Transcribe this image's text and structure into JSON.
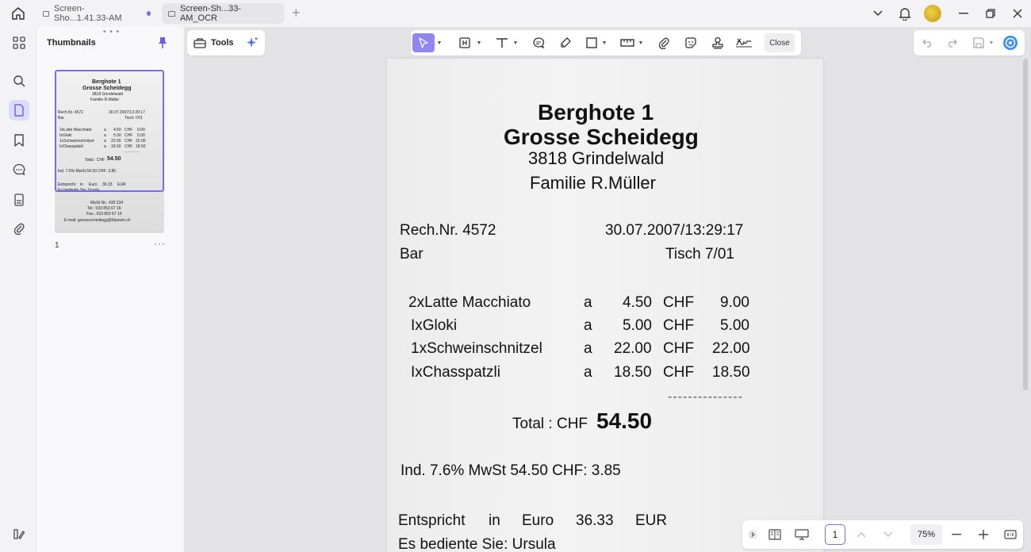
{
  "window": {
    "tabs": [
      {
        "label": "Screen-Sho...1.41.33-AM",
        "modified": true
      },
      {
        "label": "Screen-Sh...33-AM_OCR",
        "active": true
      }
    ]
  },
  "thumbnails": {
    "title": "Thumbnails",
    "page_number": "1",
    "more": "···",
    "preview_lines": [
      "Berghote 1",
      "Grosse Scheidegg",
      "3818 Grindelwald",
      "Familie R.Müller",
      "Rech.Nr. 4572",
      "30.07.2007/13:29:17",
      "Bar",
      "Tisch 7/01",
      "2xLatte Macchiato",
      "a",
      "4.50",
      "CHF",
      "9.00",
      "IxGloki",
      "a",
      "5.00",
      "CHF",
      "5.00",
      "1xSchweinschnitzel",
      "a",
      "22.00",
      "CHF",
      "22.00",
      "IxChasspätzli",
      "a",
      "18.50",
      "CHF",
      "18.50",
      "Total : CHF",
      "54.50",
      "Ind. 7.6% MwSt 54.50 CHF: 3.85",
      "Entspricht",
      "in",
      "Euro",
      "36.33",
      "EUR",
      "Es bediente Sie: Ursula",
      "MwSt Nr.: 430 234",
      "Tel.: 033 853 67 16",
      "Fax.: 033 853 67 19",
      "E-mail: grossescheidegg@bluewin.ch"
    ]
  },
  "toolbar": {
    "tools_label": "Tools",
    "close_label": "Close"
  },
  "receipt": {
    "line1": "Berghote 1",
    "line2": "Grosse Scheidegg",
    "line3": "3818 Grindelwald",
    "line4": "Familie R.Müller",
    "rech": "Rech.Nr. 4572",
    "datetime": "30.07.2007/13:29:17",
    "bar": "Bar",
    "tisch": "Tisch 7/01",
    "items": [
      {
        "name": "2xLatte Macchiato",
        "a": "a",
        "price": "4.50",
        "cur": "CHF",
        "total": "9.00"
      },
      {
        "name": "IxGloki",
        "a": "a",
        "price": "5.00",
        "cur": "CHF",
        "total": "5.00"
      },
      {
        "name": "1xSchweinschnitzel",
        "a": "a",
        "price": "22.00",
        "cur": "CHF",
        "total": "22.00"
      },
      {
        "name": "IxChasspatzli",
        "a": "a",
        "price": "18.50",
        "cur": "CHF",
        "total": "18.50"
      }
    ],
    "dashes": "---------------",
    "total_label": "Total : CHF",
    "total_value": "54.50",
    "vat": "Ind. 7.6% MwSt 54.50 CHF: 3.85",
    "euro": {
      "w1": "Entspricht",
      "w2": "in",
      "w3": "Euro",
      "w4": "36.33",
      "w5": "EUR"
    },
    "served": "Es bediente Sie: Ursula"
  },
  "navigation": {
    "page": "1",
    "zoom": "75%"
  }
}
